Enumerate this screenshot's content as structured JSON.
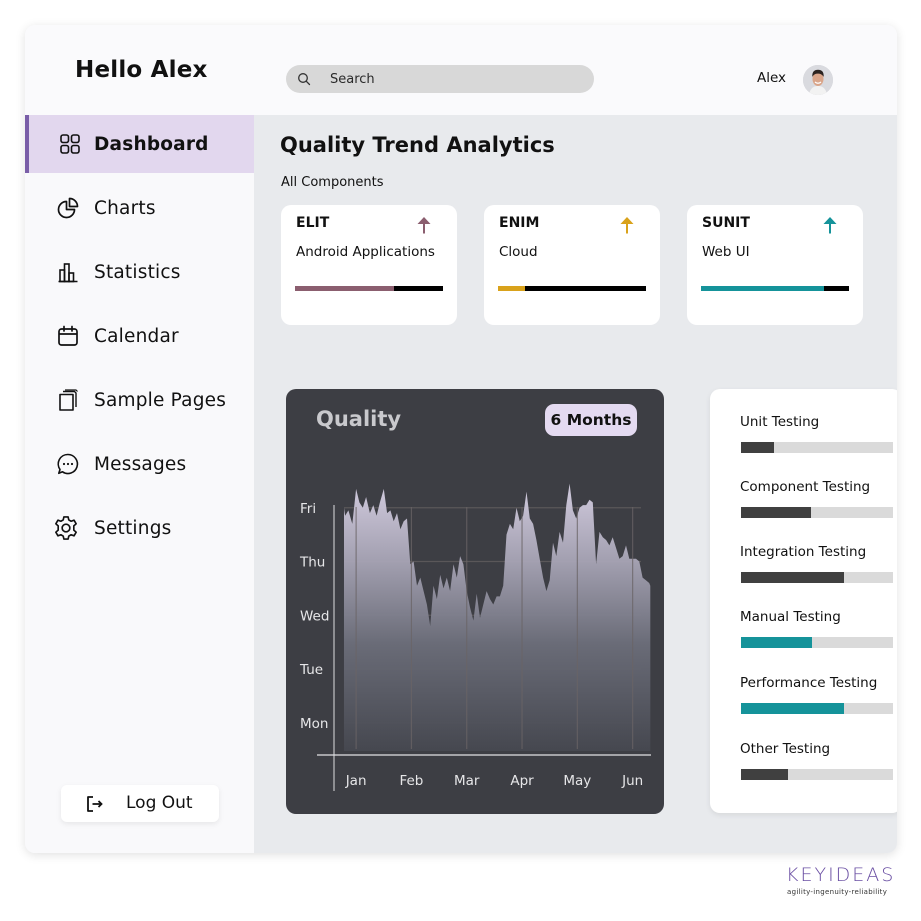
{
  "header": {
    "greeting": "Hello Alex",
    "search": {
      "placeholder": "Search",
      "value": ""
    },
    "user": {
      "name": "Alex"
    }
  },
  "sidebar": {
    "items": [
      {
        "label": "Dashboard",
        "icon": "dashboard-grid-icon",
        "active": true
      },
      {
        "label": "Charts",
        "icon": "pie-chart-icon",
        "active": false
      },
      {
        "label": "Statistics",
        "icon": "bar-chart-icon",
        "active": false
      },
      {
        "label": "Calendar",
        "icon": "calendar-icon",
        "active": false
      },
      {
        "label": "Sample Pages",
        "icon": "pages-icon",
        "active": false
      },
      {
        "label": "Messages",
        "icon": "chat-bubble-icon",
        "active": false
      },
      {
        "label": "Settings",
        "icon": "gear-icon",
        "active": false
      }
    ],
    "logout": {
      "label": "Log Out",
      "icon": "logout-icon"
    }
  },
  "main": {
    "title": "Quality Trend Analytics",
    "subtitle": "All Components",
    "components": [
      {
        "code": "ELIT",
        "name": "Android Applications",
        "trend": "up",
        "progress": 0.67,
        "color": "#8b5e6f"
      },
      {
        "code": "ENIM",
        "name": "Cloud",
        "trend": "up",
        "progress": 0.18,
        "color": "#d9a21b"
      },
      {
        "code": "SUNIT",
        "name": "Web UI",
        "trend": "up",
        "progress": 0.83,
        "color": "#15939a"
      }
    ],
    "quality_chart": {
      "title": "Quality",
      "range_button": "6 Months"
    },
    "testing": [
      {
        "label": "Unit Testing",
        "progress": 0.22,
        "color": "#404040"
      },
      {
        "label": "Component Testing",
        "progress": 0.46,
        "color": "#404040"
      },
      {
        "label": "Integration Testing",
        "progress": 0.68,
        "color": "#404040"
      },
      {
        "label": "Manual Testing",
        "progress": 0.47,
        "color": "#15939a"
      },
      {
        "label": "Performance Testing",
        "progress": 0.68,
        "color": "#15939a"
      },
      {
        "label": "Other Testing",
        "progress": 0.31,
        "color": "#404040"
      }
    ]
  },
  "brand": {
    "name": "KEYIDEAS",
    "tagline": "agility-ingenuity-reliability"
  },
  "chart_data": {
    "type": "area",
    "title": "Quality",
    "xlabel": "",
    "ylabel": "",
    "x_tick_labels": [
      "Jan",
      "Feb",
      "Mar",
      "Apr",
      "May",
      "Jun"
    ],
    "y_tick_labels": [
      "Mon",
      "Tue",
      "Wed",
      "Thu",
      "Fri"
    ],
    "ylim": [
      0.4,
      5.2
    ],
    "xlim": [
      0.6,
      6.35
    ],
    "grid": true,
    "series": [
      {
        "name": "Quality",
        "x": [
          0.78,
          0.8,
          0.86,
          0.93,
          1.0,
          1.06,
          1.12,
          1.18,
          1.25,
          1.31,
          1.37,
          1.43,
          1.5,
          1.56,
          1.62,
          1.68,
          1.74,
          1.8,
          1.86,
          1.92,
          1.98,
          2.04,
          2.1,
          2.16,
          2.22,
          2.28,
          2.34,
          2.4,
          2.46,
          2.52,
          2.58,
          2.64,
          2.7,
          2.76,
          2.82,
          2.88,
          2.94,
          3.0,
          3.06,
          3.12,
          3.18,
          3.24,
          3.3,
          3.36,
          3.42,
          3.48,
          3.54,
          3.6,
          3.66,
          3.72,
          3.78,
          3.84,
          3.9,
          3.96,
          4.02,
          4.08,
          4.14,
          4.2,
          4.26,
          4.32,
          4.38,
          4.44,
          4.5,
          4.56,
          4.62,
          4.68,
          4.74,
          4.8,
          4.86,
          4.92,
          4.98,
          5.04,
          5.1,
          5.16,
          5.22,
          5.28,
          5.34,
          5.4,
          5.46,
          5.52,
          5.58,
          5.64,
          5.7,
          5.76,
          5.82,
          5.88,
          5.94,
          6.0,
          6.06,
          6.12,
          6.18,
          6.24,
          6.3,
          6.32
        ],
        "values": [
          5.0,
          4.85,
          4.95,
          4.7,
          5.35,
          5.1,
          5.0,
          5.2,
          4.9,
          5.05,
          4.85,
          5.1,
          5.35,
          4.9,
          4.95,
          4.75,
          4.9,
          4.6,
          4.75,
          4.8,
          3.95,
          4.0,
          3.55,
          3.7,
          3.45,
          3.2,
          2.8,
          3.55,
          3.3,
          3.75,
          3.5,
          3.7,
          3.45,
          3.95,
          3.7,
          4.1,
          3.95,
          3.45,
          3.15,
          2.9,
          3.4,
          2.95,
          3.2,
          3.45,
          3.3,
          3.2,
          3.35,
          3.35,
          3.55,
          4.5,
          4.7,
          4.6,
          5.0,
          4.75,
          4.85,
          5.3,
          4.8,
          4.7,
          4.4,
          4.05,
          3.7,
          3.45,
          3.65,
          4.35,
          4.1,
          4.55,
          4.35,
          5.05,
          5.45,
          4.95,
          4.8,
          5.0,
          5.05,
          5.05,
          5.15,
          5.1,
          3.95,
          4.55,
          4.45,
          4.4,
          4.3,
          4.45,
          4.25,
          4.05,
          4.1,
          4.3,
          4.05,
          4.05,
          4.05,
          4.0,
          3.7,
          3.65,
          3.6,
          3.55
        ]
      }
    ]
  }
}
